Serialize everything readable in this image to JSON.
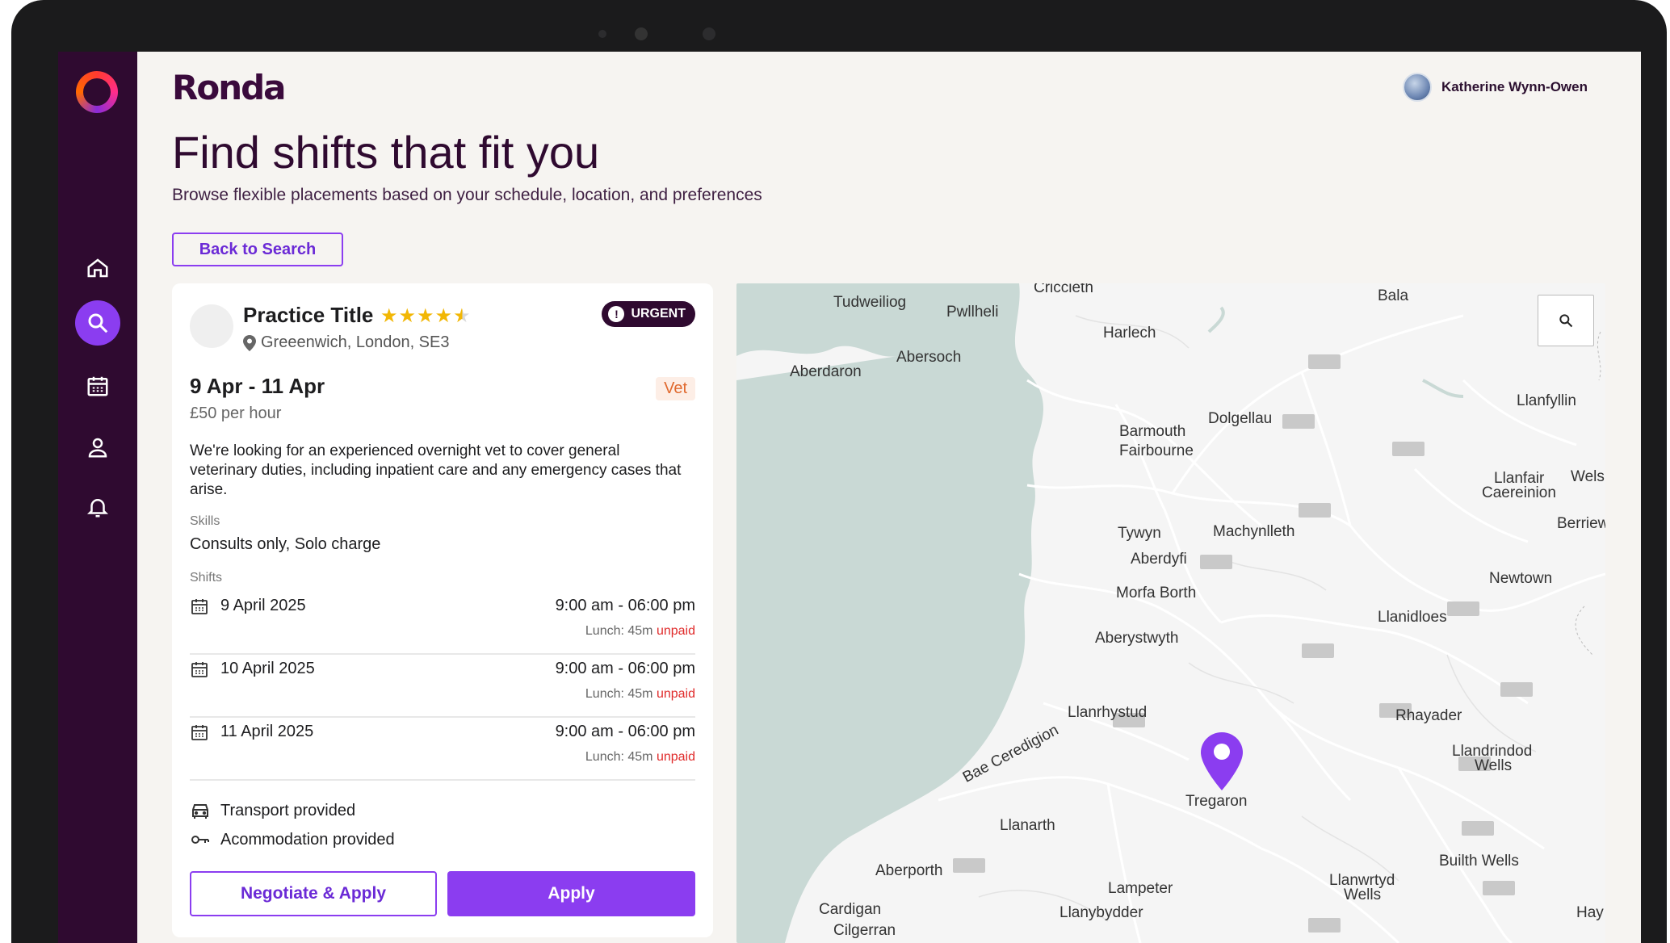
{
  "app": {
    "brand": "Ronda"
  },
  "user": {
    "name": "Katherine Wynn-Owen"
  },
  "sidebar": {
    "items": [
      {
        "icon": "home-icon",
        "active": false
      },
      {
        "icon": "search-icon",
        "active": true
      },
      {
        "icon": "calendar-icon",
        "active": false
      },
      {
        "icon": "person-icon",
        "active": false
      },
      {
        "icon": "bell-icon",
        "active": false
      }
    ]
  },
  "page": {
    "title": "Find shifts that fit you",
    "subtitle": "Browse flexible placements based on your schedule, location, and preferences",
    "back_label": "Back to Search"
  },
  "listing": {
    "practice_title": "Practice Title",
    "rating": 4.5,
    "location": "Greeenwich, London, SE3",
    "urgent_label": "URGENT",
    "dates": "9 Apr - 11 Apr",
    "rate": "£50 per hour",
    "role_tag": "Vet",
    "description": "We're looking for an experienced overnight vet to cover general veterinary duties, including inpatient care and any emergency cases that arise.",
    "skills_label": "Skills",
    "skills": "Consults only, Solo charge",
    "shifts_label": "Shifts",
    "shifts": [
      {
        "date": "9 April 2025",
        "time": "9:00 am - 06:00 pm",
        "lunch": "Lunch: 45m",
        "lunch_status": "unpaid"
      },
      {
        "date": "10 April 2025",
        "time": "9:00 am - 06:00 pm",
        "lunch": "Lunch: 45m",
        "lunch_status": "unpaid"
      },
      {
        "date": "11 April 2025",
        "time": "9:00 am - 06:00 pm",
        "lunch": "Lunch: 45m",
        "lunch_status": "unpaid"
      }
    ],
    "perks": [
      {
        "icon": "car-icon",
        "label": "Transport provided"
      },
      {
        "icon": "key-icon",
        "label": "Acommodation provided"
      }
    ],
    "negotiate_label": "Negotiate & Apply",
    "apply_label": "Apply"
  },
  "map": {
    "pin_label": "Tregaron",
    "places": [
      "Criccieth",
      "Tudweiliog",
      "Pwllheli",
      "Bala",
      "Harlech",
      "Abersoch",
      "Aberdaron",
      "Llanfyllin",
      "Dolgellau",
      "Barmouth",
      "Fairbourne",
      "Llanfair",
      "Caereinion",
      "Wels",
      "Berriew",
      "Tywyn",
      "Machynlleth",
      "Aberdyfi",
      "Newtown",
      "Morfa Borth",
      "Llanidloes",
      "Aberystwyth",
      "Llanrhystud",
      "Rhayader",
      "Bae Ceredigion",
      "Llanarth",
      "Llandrindod",
      "Wells",
      "Builth Wells",
      "Aberporth",
      "Lampeter",
      "Llanwrtyd",
      "Wells",
      "Cardigan",
      "Cilgerran",
      "Llanybydder",
      "Hay"
    ],
    "colors": {
      "sea": "#c9d9d5",
      "land": "#f5f5f5",
      "road": "#ffffff",
      "pin": "#8b3df0"
    }
  },
  "colors": {
    "accent": "#8b3df0",
    "sidebar": "#2f0a30",
    "urgent": "#2f0a30",
    "unpaid": "#e02b2b"
  }
}
